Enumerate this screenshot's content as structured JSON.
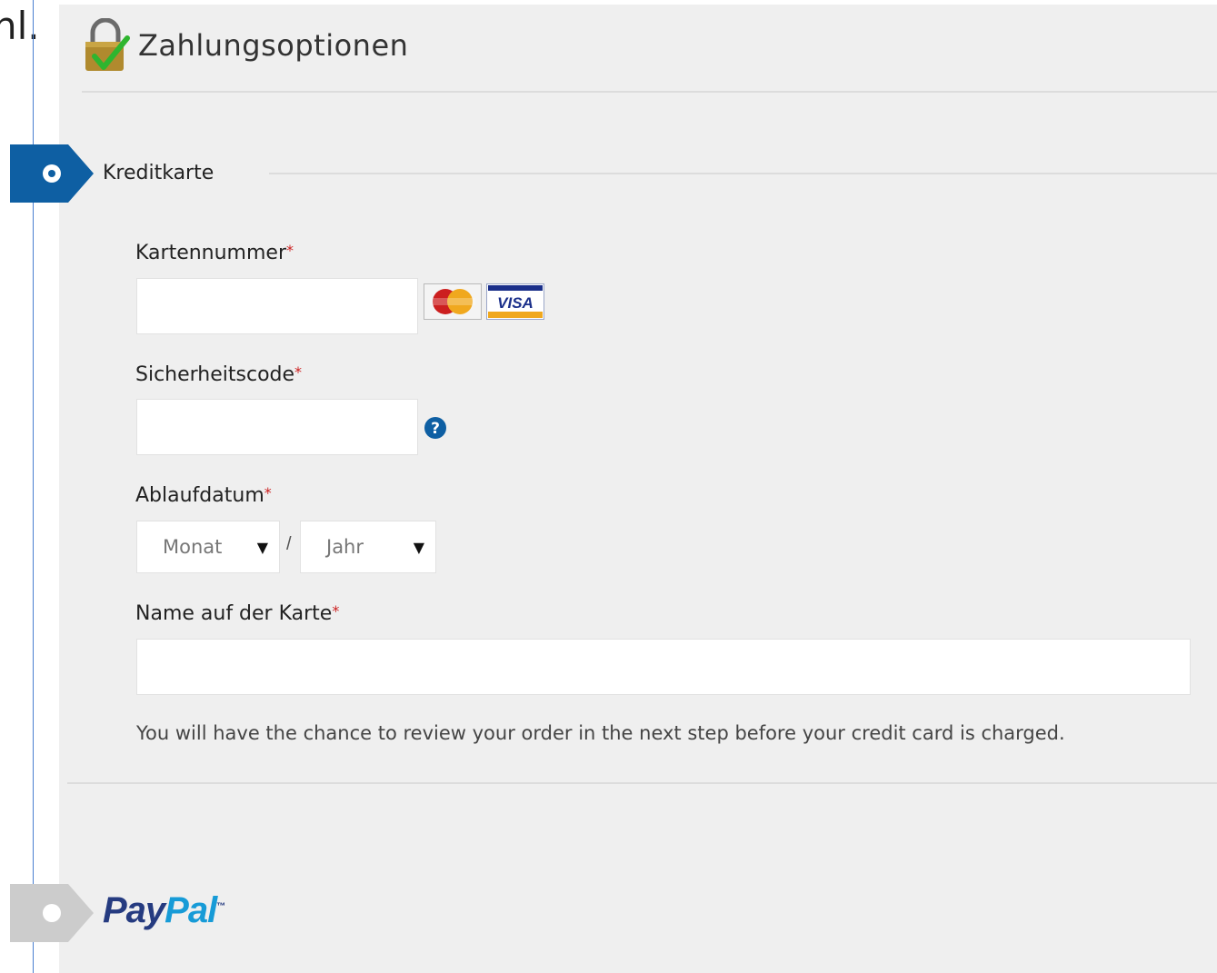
{
  "background_text": "hl.",
  "header": {
    "title": "Zahlungsoptionen",
    "icon": "lock-check-icon"
  },
  "credit_card": {
    "label": "Kreditkarte",
    "selected": true,
    "card_number": {
      "label": "Kartennummer",
      "required_mark": "*",
      "value": ""
    },
    "card_logos": [
      "MasterCard",
      "VISA"
    ],
    "security_code": {
      "label": "Sicherheitscode",
      "required_mark": "*",
      "value": "",
      "help_icon": "question-icon"
    },
    "expiry": {
      "label": "Ablaufdatum",
      "required_mark": "*",
      "month_placeholder": "Monat",
      "year_placeholder": "Jahr",
      "separator": "/"
    },
    "cardholder": {
      "label": "Name auf der Karte",
      "required_mark": "*",
      "value": ""
    },
    "note": "You will have the chance to review your order in the next step before your credit card is charged."
  },
  "paypal": {
    "label_pay": "Pay",
    "label_pal": "Pal",
    "trademark": "™",
    "selected": false
  },
  "colors": {
    "accent_blue": "#0e5fa3",
    "inactive_gray": "#cccccc",
    "required_red": "#cc1f1f",
    "panel_bg": "#efefef",
    "paypal_dark": "#253b80",
    "paypal_light": "#179bd7"
  }
}
